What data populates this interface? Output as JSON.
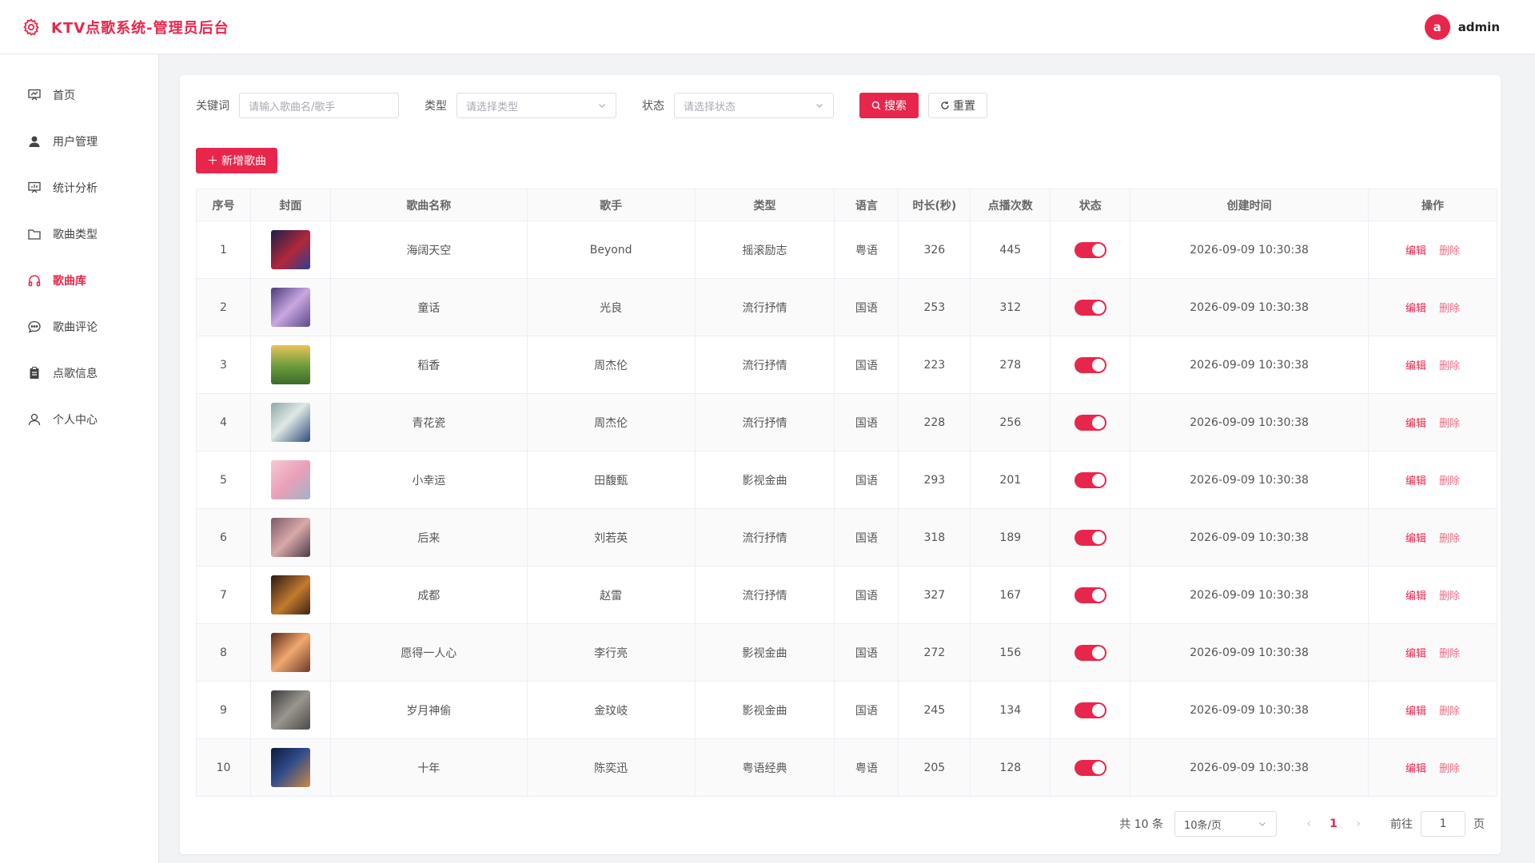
{
  "header": {
    "title": "KTV点歌系统-管理员后台",
    "avatar_letter": "a",
    "username": "admin"
  },
  "sidebar": {
    "items": [
      {
        "label": "首页",
        "icon": "dashboard-icon"
      },
      {
        "label": "用户管理",
        "icon": "user-icon"
      },
      {
        "label": "统计分析",
        "icon": "chart-icon"
      },
      {
        "label": "歌曲类型",
        "icon": "folder-icon"
      },
      {
        "label": "歌曲库",
        "icon": "headphones-icon",
        "active": true
      },
      {
        "label": "歌曲评论",
        "icon": "comment-icon"
      },
      {
        "label": "点歌信息",
        "icon": "clipboard-icon"
      },
      {
        "label": "个人中心",
        "icon": "person-icon"
      }
    ]
  },
  "filters": {
    "keyword_label": "关键词",
    "keyword_placeholder": "请输入歌曲名/歌手",
    "type_label": "类型",
    "type_placeholder": "请选择类型",
    "status_label": "状态",
    "status_placeholder": "请选择状态",
    "search_label": "搜索",
    "reset_label": "重置"
  },
  "add_button": "新增歌曲",
  "table": {
    "headers": [
      "序号",
      "封面",
      "歌曲名称",
      "歌手",
      "类型",
      "语言",
      "时长(秒)",
      "点播次数",
      "状态",
      "创建时间",
      "操作"
    ],
    "edit_label": "编辑",
    "delete_label": "删除",
    "rows": [
      {
        "no": "1",
        "name": "海阔天空",
        "singer": "Beyond",
        "type": "摇滚励志",
        "lang": "粤语",
        "duration": "326",
        "plays": "445",
        "status": true,
        "created": "2026-09-09 10:30:38"
      },
      {
        "no": "2",
        "name": "童话",
        "singer": "光良",
        "type": "流行抒情",
        "lang": "国语",
        "duration": "253",
        "plays": "312",
        "status": true,
        "created": "2026-09-09 10:30:38"
      },
      {
        "no": "3",
        "name": "稻香",
        "singer": "周杰伦",
        "type": "流行抒情",
        "lang": "国语",
        "duration": "223",
        "plays": "278",
        "status": true,
        "created": "2026-09-09 10:30:38"
      },
      {
        "no": "4",
        "name": "青花瓷",
        "singer": "周杰伦",
        "type": "流行抒情",
        "lang": "国语",
        "duration": "228",
        "plays": "256",
        "status": true,
        "created": "2026-09-09 10:30:38"
      },
      {
        "no": "5",
        "name": "小幸运",
        "singer": "田馥甄",
        "type": "影视金曲",
        "lang": "国语",
        "duration": "293",
        "plays": "201",
        "status": true,
        "created": "2026-09-09 10:30:38"
      },
      {
        "no": "6",
        "name": "后来",
        "singer": "刘若英",
        "type": "流行抒情",
        "lang": "国语",
        "duration": "318",
        "plays": "189",
        "status": true,
        "created": "2026-09-09 10:30:38"
      },
      {
        "no": "7",
        "name": "成都",
        "singer": "赵雷",
        "type": "流行抒情",
        "lang": "国语",
        "duration": "327",
        "plays": "167",
        "status": true,
        "created": "2026-09-09 10:30:38"
      },
      {
        "no": "8",
        "name": "愿得一人心",
        "singer": "李行亮",
        "type": "影视金曲",
        "lang": "国语",
        "duration": "272",
        "plays": "156",
        "status": true,
        "created": "2026-09-09 10:30:38"
      },
      {
        "no": "9",
        "name": "岁月神偷",
        "singer": "金玟岐",
        "type": "影视金曲",
        "lang": "国语",
        "duration": "245",
        "plays": "134",
        "status": true,
        "created": "2026-09-09 10:30:38"
      },
      {
        "no": "10",
        "name": "十年",
        "singer": "陈奕迅",
        "type": "粤语经典",
        "lang": "粤语",
        "duration": "205",
        "plays": "128",
        "status": true,
        "created": "2026-09-09 10:30:38"
      }
    ]
  },
  "pagination": {
    "total_text": "共 10 条",
    "page_size": "10条/页",
    "current_page": "1",
    "goto_label": "前往",
    "goto_value": "1",
    "page_suffix": "页"
  },
  "colors": {
    "accent": "#e8264b"
  }
}
